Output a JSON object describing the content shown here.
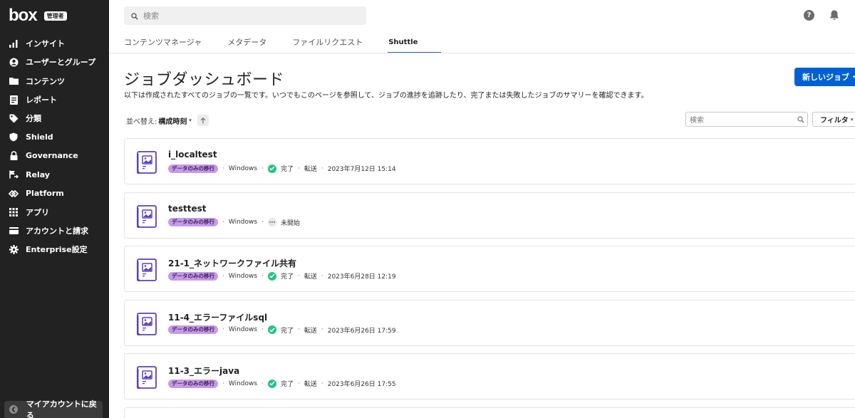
{
  "sidebar": {
    "logo": "box",
    "admin_badge": "管理者",
    "items": [
      {
        "label": "インサイト",
        "icon": "bar-chart-icon"
      },
      {
        "label": "ユーザーとグループ",
        "icon": "user-circle-icon"
      },
      {
        "label": "コンテンツ",
        "icon": "folder-icon"
      },
      {
        "label": "レポート",
        "icon": "report-icon"
      },
      {
        "label": "分類",
        "icon": "tag-icon"
      },
      {
        "label": "Shield",
        "icon": "shield-icon"
      },
      {
        "label": "Governance",
        "icon": "lock-icon"
      },
      {
        "label": "Relay",
        "icon": "relay-icon"
      },
      {
        "label": "Platform",
        "icon": "platform-icon"
      },
      {
        "label": "アプリ",
        "icon": "grid-icon"
      },
      {
        "label": "アカウントと請求",
        "icon": "card-icon"
      },
      {
        "label": "Enterprise設定",
        "icon": "gear-icon"
      }
    ],
    "back_label": "マイアカウントに戻る"
  },
  "topbar": {
    "search_placeholder": "検索",
    "help": "?"
  },
  "tabs": [
    {
      "label": "コンテンツマネージャ",
      "active": false
    },
    {
      "label": "メタデータ",
      "active": false
    },
    {
      "label": "ファイルリクエスト",
      "active": false
    },
    {
      "label": "Shuttle",
      "active": true
    }
  ],
  "header": {
    "title": "ジョブダッシュボード",
    "description": "以下は作成されたすべてのジョブの一覧です。いつでもこのページを参照して、ジョブの進捗を追跡したり、完了または失敗したジョブのサマリーを確認できます。",
    "new_job_label": "新しいジョブ"
  },
  "toolbar": {
    "sort_label": "並べ替え:",
    "sort_value": "構成時刻",
    "search_placeholder": "検索",
    "filter_label": "フィルタ"
  },
  "jobs": [
    {
      "name": "i_localtest",
      "tag": "データのみの移行",
      "platform": "Windows",
      "status": "完了",
      "status_type": "done",
      "action": "転送",
      "timestamp": "2023年7月12日 15:14"
    },
    {
      "name": "testtest",
      "tag": "データのみの移行",
      "platform": "Windows",
      "status": "未開始",
      "status_type": "pending",
      "action": "",
      "timestamp": ""
    },
    {
      "name": "21-1_ネットワークファイル共有",
      "tag": "データのみの移行",
      "platform": "Windows",
      "status": "完了",
      "status_type": "done",
      "action": "転送",
      "timestamp": "2023年6月28日 12:19"
    },
    {
      "name": "11-4_エラーファイルsql",
      "tag": "データのみの移行",
      "platform": "Windows",
      "status": "完了",
      "status_type": "done",
      "action": "転送",
      "timestamp": "2023年6月26日 17:59"
    },
    {
      "name": "11-3_エラーjava",
      "tag": "データのみの移行",
      "platform": "Windows",
      "status": "完了",
      "status_type": "done",
      "action": "転送",
      "timestamp": "2023年6月26日 17:55"
    }
  ],
  "colors": {
    "sidebar_bg": "#222222",
    "primary": "#0061d5",
    "tag_bg": "#c69ae8",
    "done": "#26c281",
    "icon_purple": "#5b3fc4"
  }
}
